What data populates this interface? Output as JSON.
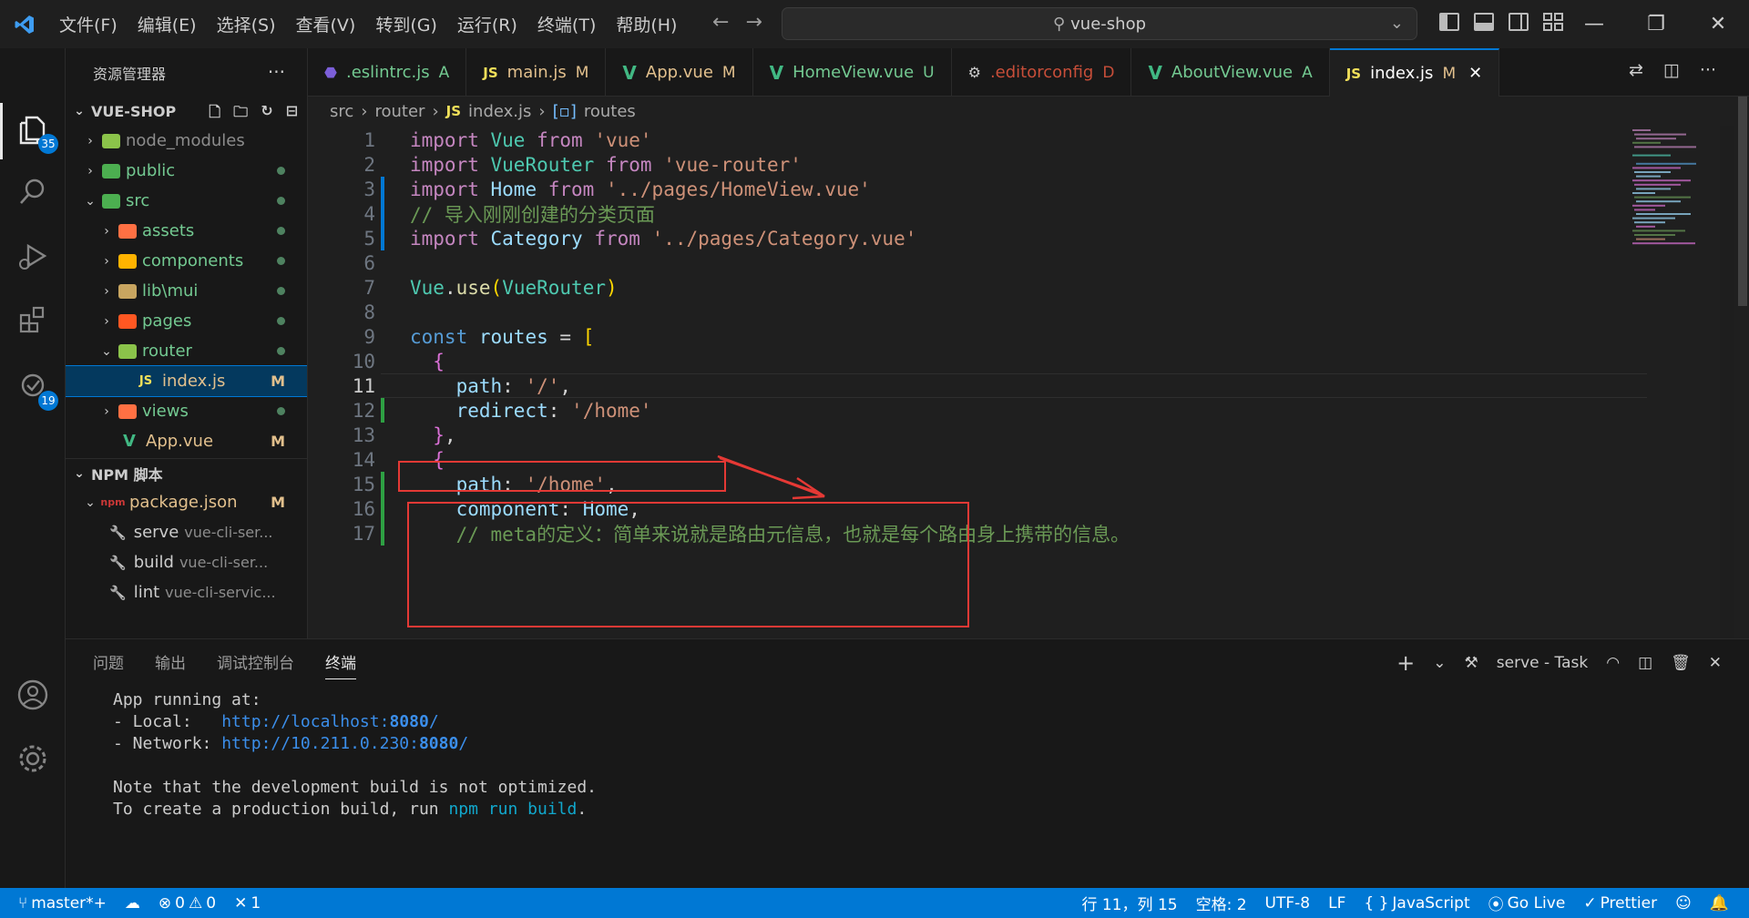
{
  "window": {
    "title": "vue-shop",
    "menus": [
      "文件(F)",
      "编辑(E)",
      "选择(S)",
      "查看(V)",
      "转到(G)",
      "运行(R)",
      "终端(T)",
      "帮助(H)"
    ]
  },
  "activity": {
    "explorer_badge": "35",
    "scm_badge": "19"
  },
  "sidebar": {
    "title": "资源管理器",
    "root": "VUE-SHOP",
    "tree": [
      {
        "name": "node_modules",
        "icon": "folder-node-icon",
        "state": "collapsed",
        "level": 0,
        "status": "ignored",
        "marker": ""
      },
      {
        "name": "public",
        "icon": "folder-public-icon",
        "state": "collapsed",
        "level": 0,
        "status": "added",
        "marker": "dot"
      },
      {
        "name": "src",
        "icon": "folder-src-icon",
        "state": "expanded",
        "level": 0,
        "status": "added",
        "marker": "dot"
      },
      {
        "name": "assets",
        "icon": "folder-assets-icon",
        "state": "collapsed",
        "level": 1,
        "status": "added",
        "marker": "dot"
      },
      {
        "name": "components",
        "icon": "folder-components-icon",
        "state": "collapsed",
        "level": 1,
        "status": "added",
        "marker": "dot"
      },
      {
        "name": "lib\\mui",
        "icon": "folder-lib-icon",
        "state": "collapsed",
        "level": 1,
        "status": "added",
        "marker": "dot"
      },
      {
        "name": "pages",
        "icon": "folder-pages-icon",
        "state": "collapsed",
        "level": 1,
        "status": "added",
        "marker": "dot"
      },
      {
        "name": "router",
        "icon": "folder-router-icon",
        "state": "expanded",
        "level": 1,
        "status": "added",
        "marker": "dot"
      },
      {
        "name": "index.js",
        "icon": "js-file-icon",
        "state": "file",
        "level": 2,
        "status": "modified",
        "marker": "M"
      },
      {
        "name": "views",
        "icon": "folder-views-icon",
        "state": "collapsed",
        "level": 1,
        "status": "added",
        "marker": "dot"
      },
      {
        "name": "App.vue",
        "icon": "vue-file-icon",
        "state": "file",
        "level": 1,
        "status": "modified",
        "marker": "M"
      }
    ],
    "npm": {
      "title": "NPM 脚本",
      "package": "package.json",
      "package_marker": "M",
      "scripts": [
        {
          "name": "serve",
          "cmd": "vue-cli-ser..."
        },
        {
          "name": "build",
          "cmd": "vue-cli-ser..."
        },
        {
          "name": "lint",
          "cmd": "vue-cli-servic..."
        }
      ]
    }
  },
  "tabs": [
    {
      "label": ".eslintrc.js",
      "badge": "A",
      "icon": "eslint-icon",
      "color": "#73c991"
    },
    {
      "label": "main.js",
      "badge": "M",
      "icon": "js-icon",
      "color": "#e2c08d"
    },
    {
      "label": "App.vue",
      "badge": "M",
      "icon": "vue-icon",
      "color": "#e2c08d"
    },
    {
      "label": "HomeView.vue",
      "badge": "U",
      "icon": "vue-icon",
      "color": "#73c991"
    },
    {
      "label": ".editorconfig",
      "badge": "D",
      "icon": "editorconfig-icon",
      "color": "#c74e39"
    },
    {
      "label": "AboutView.vue",
      "badge": "A",
      "icon": "vue-icon",
      "color": "#73c991"
    },
    {
      "label": "index.js",
      "badge": "M",
      "icon": "js-icon",
      "color": "#e2c08d",
      "active": true
    }
  ],
  "breadcrumb": [
    "src",
    "router",
    "index.js",
    "routes"
  ],
  "code": {
    "line_numbers": [
      "1",
      "2",
      "3",
      "4",
      "5",
      "6",
      "7",
      "8",
      "9",
      "10",
      "11",
      "12",
      "13",
      "14",
      "15",
      "16",
      "17"
    ],
    "lines": [
      "import Vue from 'vue'",
      "import VueRouter from 'vue-router'",
      "import Home from '../pages/HomeView.vue'",
      "// 导入刚刚创建的分类页面",
      "import Category from '../pages/Category.vue'",
      "",
      "Vue.use(VueRouter)",
      "",
      "const routes = [",
      "  {",
      "    path: '/',",
      "    redirect: '/home'",
      "  },",
      "  {",
      "    path: '/home',",
      "    component: Home,",
      "    // meta的定义：简单来说就是路由元信息，也就是每个路由身上携带的信息。"
    ],
    "current_line": "11"
  },
  "panel": {
    "tabs": [
      "问题",
      "输出",
      "调试控制台",
      "终端"
    ],
    "active_tab": "终端",
    "task": "serve - Task",
    "terminal": {
      "l1": "App running at:",
      "l2a": "- Local:   ",
      "l2b": "http://localhost:",
      "l2c": "8080",
      "l2d": "/",
      "l3a": "- Network: ",
      "l3b": "http://10.211.0.230:",
      "l3c": "8080",
      "l3d": "/",
      "l4": "Note that the development build is not optimized.",
      "l5a": "To create a production build, run ",
      "l5b": "npm run build",
      "l5c": "."
    }
  },
  "status": {
    "branch": "master*+",
    "errors": "0",
    "warnings": "0",
    "ports": "1",
    "position": "行 11，列 15",
    "spaces": "空格: 2",
    "encoding": "UTF-8",
    "eol": "LF",
    "language": "JavaScript",
    "golive": "Go Live",
    "prettier": "Prettier"
  },
  "colors": {
    "accent": "#0078d4",
    "annotation": "#e53935"
  }
}
